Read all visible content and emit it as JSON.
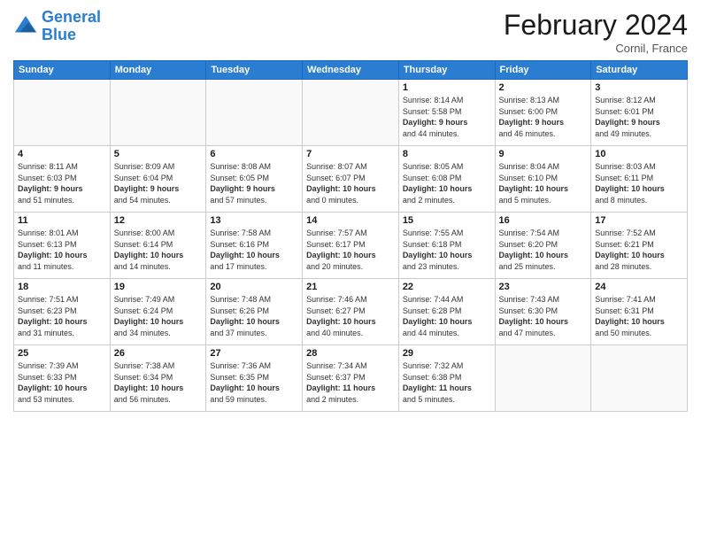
{
  "logo": {
    "line1": "General",
    "line2": "Blue"
  },
  "title": "February 2024",
  "location": "Cornil, France",
  "days_of_week": [
    "Sunday",
    "Monday",
    "Tuesday",
    "Wednesday",
    "Thursday",
    "Friday",
    "Saturday"
  ],
  "weeks": [
    [
      {
        "day": "",
        "info": []
      },
      {
        "day": "",
        "info": []
      },
      {
        "day": "",
        "info": []
      },
      {
        "day": "",
        "info": []
      },
      {
        "day": "1",
        "info": [
          "Sunrise: 8:14 AM",
          "Sunset: 5:58 PM",
          "Daylight: 9 hours",
          "and 44 minutes."
        ]
      },
      {
        "day": "2",
        "info": [
          "Sunrise: 8:13 AM",
          "Sunset: 6:00 PM",
          "Daylight: 9 hours",
          "and 46 minutes."
        ]
      },
      {
        "day": "3",
        "info": [
          "Sunrise: 8:12 AM",
          "Sunset: 6:01 PM",
          "Daylight: 9 hours",
          "and 49 minutes."
        ]
      }
    ],
    [
      {
        "day": "4",
        "info": [
          "Sunrise: 8:11 AM",
          "Sunset: 6:03 PM",
          "Daylight: 9 hours",
          "and 51 minutes."
        ]
      },
      {
        "day": "5",
        "info": [
          "Sunrise: 8:09 AM",
          "Sunset: 6:04 PM",
          "Daylight: 9 hours",
          "and 54 minutes."
        ]
      },
      {
        "day": "6",
        "info": [
          "Sunrise: 8:08 AM",
          "Sunset: 6:05 PM",
          "Daylight: 9 hours",
          "and 57 minutes."
        ]
      },
      {
        "day": "7",
        "info": [
          "Sunrise: 8:07 AM",
          "Sunset: 6:07 PM",
          "Daylight: 10 hours",
          "and 0 minutes."
        ]
      },
      {
        "day": "8",
        "info": [
          "Sunrise: 8:05 AM",
          "Sunset: 6:08 PM",
          "Daylight: 10 hours",
          "and 2 minutes."
        ]
      },
      {
        "day": "9",
        "info": [
          "Sunrise: 8:04 AM",
          "Sunset: 6:10 PM",
          "Daylight: 10 hours",
          "and 5 minutes."
        ]
      },
      {
        "day": "10",
        "info": [
          "Sunrise: 8:03 AM",
          "Sunset: 6:11 PM",
          "Daylight: 10 hours",
          "and 8 minutes."
        ]
      }
    ],
    [
      {
        "day": "11",
        "info": [
          "Sunrise: 8:01 AM",
          "Sunset: 6:13 PM",
          "Daylight: 10 hours",
          "and 11 minutes."
        ]
      },
      {
        "day": "12",
        "info": [
          "Sunrise: 8:00 AM",
          "Sunset: 6:14 PM",
          "Daylight: 10 hours",
          "and 14 minutes."
        ]
      },
      {
        "day": "13",
        "info": [
          "Sunrise: 7:58 AM",
          "Sunset: 6:16 PM",
          "Daylight: 10 hours",
          "and 17 minutes."
        ]
      },
      {
        "day": "14",
        "info": [
          "Sunrise: 7:57 AM",
          "Sunset: 6:17 PM",
          "Daylight: 10 hours",
          "and 20 minutes."
        ]
      },
      {
        "day": "15",
        "info": [
          "Sunrise: 7:55 AM",
          "Sunset: 6:18 PM",
          "Daylight: 10 hours",
          "and 23 minutes."
        ]
      },
      {
        "day": "16",
        "info": [
          "Sunrise: 7:54 AM",
          "Sunset: 6:20 PM",
          "Daylight: 10 hours",
          "and 25 minutes."
        ]
      },
      {
        "day": "17",
        "info": [
          "Sunrise: 7:52 AM",
          "Sunset: 6:21 PM",
          "Daylight: 10 hours",
          "and 28 minutes."
        ]
      }
    ],
    [
      {
        "day": "18",
        "info": [
          "Sunrise: 7:51 AM",
          "Sunset: 6:23 PM",
          "Daylight: 10 hours",
          "and 31 minutes."
        ]
      },
      {
        "day": "19",
        "info": [
          "Sunrise: 7:49 AM",
          "Sunset: 6:24 PM",
          "Daylight: 10 hours",
          "and 34 minutes."
        ]
      },
      {
        "day": "20",
        "info": [
          "Sunrise: 7:48 AM",
          "Sunset: 6:26 PM",
          "Daylight: 10 hours",
          "and 37 minutes."
        ]
      },
      {
        "day": "21",
        "info": [
          "Sunrise: 7:46 AM",
          "Sunset: 6:27 PM",
          "Daylight: 10 hours",
          "and 40 minutes."
        ]
      },
      {
        "day": "22",
        "info": [
          "Sunrise: 7:44 AM",
          "Sunset: 6:28 PM",
          "Daylight: 10 hours",
          "and 44 minutes."
        ]
      },
      {
        "day": "23",
        "info": [
          "Sunrise: 7:43 AM",
          "Sunset: 6:30 PM",
          "Daylight: 10 hours",
          "and 47 minutes."
        ]
      },
      {
        "day": "24",
        "info": [
          "Sunrise: 7:41 AM",
          "Sunset: 6:31 PM",
          "Daylight: 10 hours",
          "and 50 minutes."
        ]
      }
    ],
    [
      {
        "day": "25",
        "info": [
          "Sunrise: 7:39 AM",
          "Sunset: 6:33 PM",
          "Daylight: 10 hours",
          "and 53 minutes."
        ]
      },
      {
        "day": "26",
        "info": [
          "Sunrise: 7:38 AM",
          "Sunset: 6:34 PM",
          "Daylight: 10 hours",
          "and 56 minutes."
        ]
      },
      {
        "day": "27",
        "info": [
          "Sunrise: 7:36 AM",
          "Sunset: 6:35 PM",
          "Daylight: 10 hours",
          "and 59 minutes."
        ]
      },
      {
        "day": "28",
        "info": [
          "Sunrise: 7:34 AM",
          "Sunset: 6:37 PM",
          "Daylight: 11 hours",
          "and 2 minutes."
        ]
      },
      {
        "day": "29",
        "info": [
          "Sunrise: 7:32 AM",
          "Sunset: 6:38 PM",
          "Daylight: 11 hours",
          "and 5 minutes."
        ]
      },
      {
        "day": "",
        "info": []
      },
      {
        "day": "",
        "info": []
      }
    ]
  ]
}
